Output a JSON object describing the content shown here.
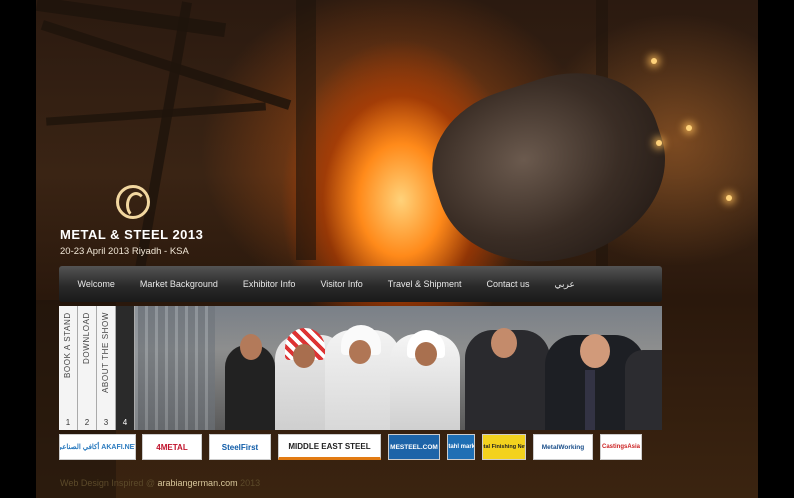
{
  "header": {
    "title": "METAL & STEEL 2013",
    "subtitle": "20-23 April 2013 Riyadh - KSA"
  },
  "nav": {
    "items": [
      "Welcome",
      "Market Background",
      "Exhibitor Info",
      "Visitor Info",
      "Travel & Shipment",
      "Contact us",
      "عربي"
    ]
  },
  "tabs": [
    {
      "label": "BOOK A STAND",
      "number": "1"
    },
    {
      "label": "DOWNLOAD",
      "number": "2"
    },
    {
      "label": "ABOUT THE SHOW",
      "number": "3"
    },
    {
      "label": "",
      "number": "4"
    }
  ],
  "sponsors": [
    {
      "name": "akafi-net",
      "text": "أكافي الصناعي AKAFI.NET"
    },
    {
      "name": "4metal",
      "text": "4METAL"
    },
    {
      "name": "steelfirst",
      "text": "SteelFirst"
    },
    {
      "name": "middle-east-steel",
      "text": "MIDDLE EAST STEEL"
    },
    {
      "name": "mesteel",
      "text": "MESTEEL.COM"
    },
    {
      "name": "stahl",
      "text": "stahl markt"
    },
    {
      "name": "metal-finishing",
      "text": "Metal Finishing News"
    },
    {
      "name": "metalworking",
      "text": "MetalWorking"
    },
    {
      "name": "castings",
      "text": "CastingsAsia"
    }
  ],
  "footer": {
    "prefix": "Web Design Inspired @",
    "link": "arabiangerman.com",
    "suffix": "2013"
  },
  "colors": {
    "nav_bg": "#2a2a2a",
    "accent": "#d8c79b"
  }
}
